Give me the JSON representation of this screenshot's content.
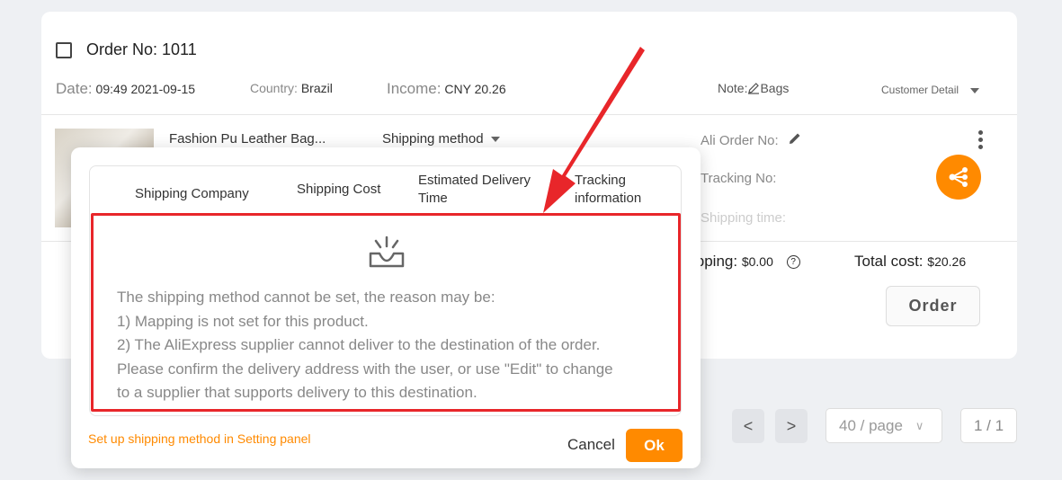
{
  "order": {
    "order_no": "Order No: 1011",
    "date_label": "Date:",
    "date_value": "09:49 2021-09-15",
    "country_label": "Country:",
    "country_value": "Brazil",
    "income_label": "Income:",
    "income_value": "CNY 20.26",
    "note_label": "Note:",
    "note_value": "Bags",
    "customer_detail": "Customer Detail"
  },
  "product": {
    "title": "Fashion Pu Leather Bag...",
    "shipping_method": "Shipping method",
    "ali_order_label": "Ali Order No:",
    "tracking_label": "Tracking No:",
    "shipping_time_label": "Shipping time:",
    "shipping_cost_label": "ipping:",
    "shipping_cost_value": "$0.00",
    "total_label": "Total cost:",
    "total_value": "$20.26",
    "order_button": "Order"
  },
  "pagination": {
    "prev": "<",
    "next": ">",
    "per_page": "40 / page",
    "per_page_caret": "∨",
    "page": "1 / 1"
  },
  "popup": {
    "headers": [
      "Shipping Company",
      "Shipping Cost",
      "Estimated Delivery Time",
      "Tracking information"
    ],
    "header_lines": {
      "delivery": [
        "Estimated Delivery",
        "Time"
      ],
      "tracking": [
        "Tracking",
        "information"
      ]
    },
    "empty_lines": [
      "The shipping method cannot be set, the reason may be:",
      "1) Mapping is not set for this product.",
      "2) The AliExpress supplier cannot deliver to the destination of the order.",
      "Please confirm the delivery address with the user, or use \"Edit\" to change",
      "to a supplier that supports delivery to this destination."
    ],
    "setup_link": "Set up shipping method in Setting panel",
    "cancel": "Cancel",
    "ok": "Ok"
  },
  "colors": {
    "accent": "#ff8a00",
    "highlight": "#e8262a"
  },
  "icons": [
    "edit-icon",
    "pencil-icon",
    "more-vertical-icon",
    "share-icon",
    "help-circle-icon",
    "empty-inbox-icon",
    "chevron-left-icon",
    "chevron-right-icon",
    "chevron-down-icon"
  ]
}
